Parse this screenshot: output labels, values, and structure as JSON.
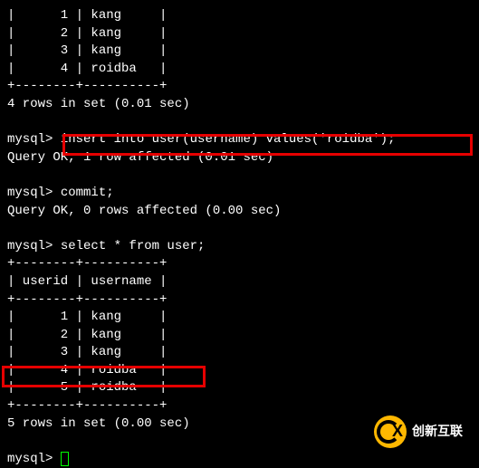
{
  "table1": {
    "border_top": "+--------+----------+",
    "rows": [
      "|      1 | kang     |",
      "|      2 | kang     |",
      "|      3 | kang     |",
      "|      4 | roidba   |"
    ],
    "border_bottom": "+--------+----------+"
  },
  "result1": "4 rows in set (0.01 sec)",
  "prompt1": "mysql> ",
  "cmd1": "insert into user(username) values('roidba');",
  "result2": "Query OK, 1 row affected (0.01 sec)",
  "prompt2": "mysql> ",
  "cmd2": "commit;",
  "result3": "Query OK, 0 rows affected (0.00 sec)",
  "prompt3": "mysql> ",
  "cmd3": "select * from user;",
  "table2": {
    "border_top": "+--------+----------+",
    "header": "| userid | username |",
    "border_mid": "+--------+----------+",
    "rows": [
      "|      1 | kang     |",
      "|      2 | kang     |",
      "|      3 | kang     |",
      "|      4 | roidba   |",
      "|      5 | roidba   |"
    ],
    "border_bottom": "+--------+----------+"
  },
  "result4": "5 rows in set (0.00 sec)",
  "prompt4": "mysql> ",
  "logo_text": "创新互联",
  "chart_data": {
    "type": "table",
    "title": "user",
    "columns": [
      "userid",
      "username"
    ],
    "rows_before_insert": [
      [
        1,
        "kang"
      ],
      [
        2,
        "kang"
      ],
      [
        3,
        "kang"
      ],
      [
        4,
        "roidba"
      ]
    ],
    "rows_after_insert": [
      [
        1,
        "kang"
      ],
      [
        2,
        "kang"
      ],
      [
        3,
        "kang"
      ],
      [
        4,
        "roidba"
      ],
      [
        5,
        "roidba"
      ]
    ]
  }
}
